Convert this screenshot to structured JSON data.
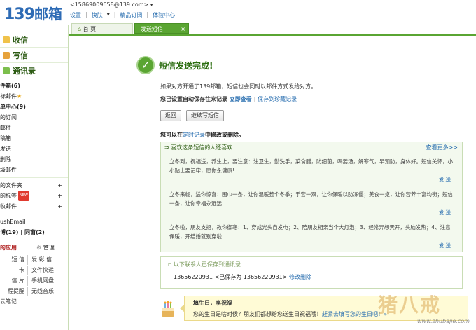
{
  "header": {
    "logo_num": "139",
    "logo_text": "邮箱",
    "account": "<15869009658@139.com>",
    "menu": [
      "设置",
      "换肤",
      "精品订阅",
      "体验中心"
    ]
  },
  "sidebar": {
    "big_items": [
      "收信",
      "写信",
      "通讯录"
    ],
    "items": [
      "件箱(6)",
      "标邮件",
      "单中心(9)",
      "的订阅",
      "邮件",
      "稿箱",
      "发送",
      "删除",
      "圾邮件",
      "的文件夹",
      "的标签",
      "收邮件",
      "ushEmail",
      "博(19)",
      "同窗(2)"
    ],
    "new_badge": "NEW",
    "apps_title": "的应用",
    "apps_manage": "管理",
    "apps": [
      [
        "短 信",
        "发 彩 信"
      ],
      [
        "卡",
        "文件快递"
      ],
      [
        "信 片",
        "手机网盘"
      ],
      [
        "程提醒",
        "无线音乐"
      ],
      [
        "云笔记",
        ""
      ]
    ]
  },
  "tabs": {
    "home": "首 页",
    "active": "发送短信"
  },
  "main": {
    "success_title": "短信发送完成!",
    "info": "如果对方开通了139邮箱，短信也会同时以邮件方式发给对方。",
    "autosave": "您已设置自动保存往来记录",
    "view_now": "立即查看",
    "save_fav": "保存到珍藏记录",
    "btn_back": "返回",
    "btn_continue": "继续写短信",
    "timer_prefix": "您可以在",
    "timer_link": "定时记录",
    "timer_suffix": "中修改或删除。",
    "rec_title": "⇒ 喜欢这条短信的人还喜欢",
    "more": "查看更多>>",
    "messages": [
      "立冬到，祝福送，养生上，要注意：注卫生，勤洗手，菜食醋，防细菌，喝姜汤，解寒气，早预防，身体好。短信关怀，小小贴士要记牢，愿你永健康!",
      "立冬来临，送你惊喜：围巾一条，让你温暖整个冬季；手套一双，让你保暖以防冻僵；美食一桌，让你营养丰富均衡；短信一条，让你幸福永远远!",
      "立冬啦，朋友支招，教你御寒：1、穿成光头自发电；2、陪朋友相亲当个大灯泡；3、经常异想天开，头脑发热；4、注意保暖，开结婚就别穿啦!"
    ],
    "send": "发 送",
    "saved_label": "以下联系人已保存到通讯录",
    "saved_number": "13656220931 <已保存为 13656220931>",
    "saved_delete": "修改删除",
    "bday_title": "填生日，享祝福",
    "bday_desc": "您的生日是啥时候？朋友们都想给您送生日祝福哦！",
    "bday_link": "赶紧去填写您的生日吧！",
    "bday_more": "»"
  },
  "watermark": {
    "big": "猪八戒",
    "small": "www.zhubajie.com"
  },
  "colors": {
    "accent": "#5aa532",
    "link": "#2a6fb0",
    "logo": "#2d6bb5"
  }
}
